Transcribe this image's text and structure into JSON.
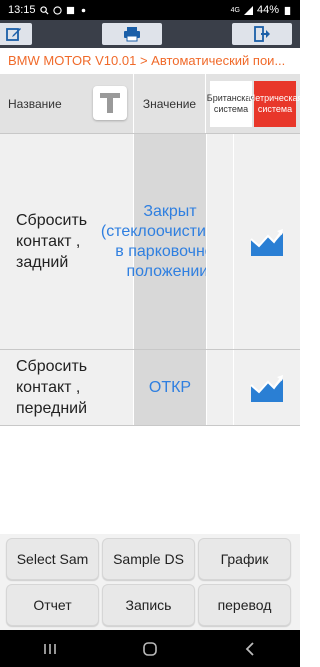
{
  "status_bar": {
    "time": "13:15",
    "signal_label": "4G",
    "battery": "44%"
  },
  "toolbar": {
    "left_icon": "edit-icon",
    "middle_icon": "printer-icon",
    "right_icon": "exit-icon"
  },
  "breadcrumb": "BMW MOTOR V10.01 > Автоматический пои...",
  "table": {
    "header": {
      "name": "Название",
      "value": "Значение",
      "unit_british": "Британская система",
      "unit_metric": "Метрическая система"
    },
    "rows": [
      {
        "name": "Сбросить контакт , задний",
        "value": "Закрыт (стеклоочиститель в парковочном положении)"
      },
      {
        "name": "Сбросить контакт , передний",
        "value": "ОТКР"
      }
    ]
  },
  "buttons": {
    "select_sample": "Select Sam",
    "sample_ds": "Sample DS",
    "graph": "График",
    "report": "Отчет",
    "record": "Запись",
    "translate": "перевод"
  },
  "colors": {
    "accent_orange": "#f06a2a",
    "value_blue": "#2f7fe0",
    "metric_red": "#e8372a",
    "toolbar_bg": "#3a3f49"
  }
}
